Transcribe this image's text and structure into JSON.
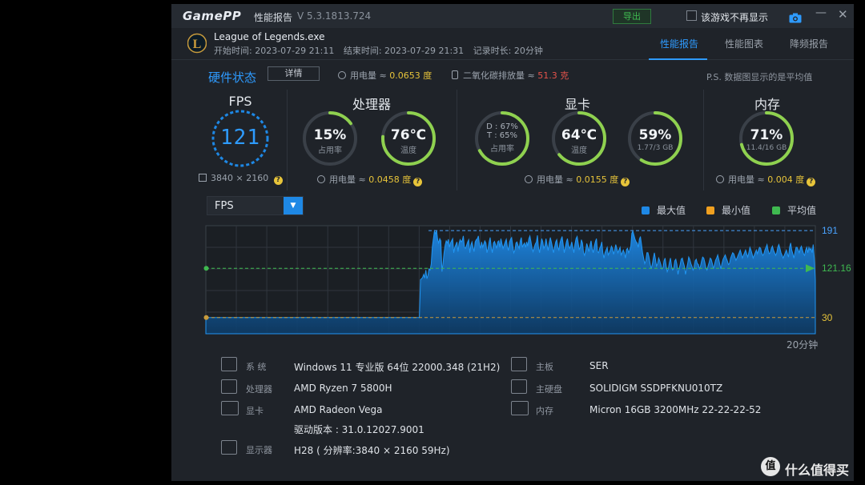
{
  "titlebar": {
    "logo": "GamePP",
    "title": "性能报告",
    "version": "V 5.3.1813.724",
    "export_label": "导出",
    "hide_game_label": "该游戏不再显示"
  },
  "header": {
    "exe": "League of Legends.exe",
    "start": "开始时间: 2023-07-29 21:11",
    "end": "结束时间: 2023-07-29 21:31",
    "duration": "记录时长: 20分钟",
    "game_icon_letter": "L",
    "tabs": [
      {
        "label": "性能报告",
        "active": true
      },
      {
        "label": "性能图表",
        "active": false
      },
      {
        "label": "降频报告",
        "active": false
      }
    ]
  },
  "summary": {
    "title": "硬件状态",
    "detail_label": "详情",
    "power_label": "用电量 ≈",
    "power_value": "0.0653 度",
    "co2_label": "二氧化碳排放量 ≈",
    "co2_value": "51.3 克",
    "ps_note": "P.S. 数据图显示的是平均值"
  },
  "sections": {
    "fps": {
      "title": "FPS",
      "value": "121",
      "resolution": "3840 × 2160"
    },
    "cpu": {
      "title": "处理器",
      "power_label": "用电量 ≈",
      "power_value": "0.0458 度"
    },
    "gpu": {
      "title": "显卡",
      "power_label": "用电量 ≈",
      "power_value": "0.0155 度"
    },
    "mem": {
      "title": "内存",
      "power_label": "用电量 ≈",
      "power_value": "0.004 度"
    }
  },
  "gauges": {
    "cpu_usage": {
      "value": "15%",
      "label": "占用率",
      "fraction": 0.15
    },
    "cpu_temp": {
      "value": "76℃",
      "label": "温度",
      "fraction": 0.76
    },
    "gpu_usage": {
      "line1": "D : 67%",
      "line2": "T : 65%",
      "label": "占用率",
      "fraction": 0.67
    },
    "gpu_temp": {
      "value": "64℃",
      "label": "温度",
      "fraction": 0.64
    },
    "gpu_mem": {
      "value": "59%",
      "label": "1.77/3 GB",
      "fraction": 0.59
    },
    "mem": {
      "value": "71%",
      "label": "11.4/16 GB",
      "fraction": 0.71
    }
  },
  "chart_controls": {
    "select_value": "FPS",
    "legend": [
      {
        "label": "最大值",
        "color": "#1e88e5"
      },
      {
        "label": "最小值",
        "color": "#f0a020"
      },
      {
        "label": "平均值",
        "color": "#3fb950"
      }
    ],
    "x_unit": "20分钟"
  },
  "chart_data": {
    "type": "area",
    "title": "",
    "xlabel": "20分钟",
    "ylabel": "",
    "ylim": [
      0,
      200
    ],
    "max_label": "191",
    "avg_label": "121.16",
    "min_label": "30",
    "max": 191,
    "avg": 121.16,
    "min": 30,
    "series": [
      {
        "values": [
          30,
          30,
          30,
          30,
          30,
          30,
          30,
          30,
          30,
          30,
          30,
          30,
          30,
          30,
          30,
          30,
          30,
          30,
          30,
          30,
          30,
          30,
          30,
          30,
          30,
          30,
          30,
          30,
          30,
          30,
          30,
          30,
          30,
          30,
          30,
          30,
          30,
          30,
          30,
          30,
          30,
          30,
          30,
          30,
          30,
          30,
          30,
          30,
          30,
          30,
          30,
          30,
          30,
          30,
          30,
          30,
          30,
          30,
          30,
          30,
          30,
          30,
          30,
          30,
          30,
          30,
          30,
          30,
          30,
          30,
          30,
          30,
          30,
          30,
          30,
          30,
          30,
          30,
          30,
          30,
          30,
          30,
          30,
          30,
          30,
          30,
          30,
          30,
          30,
          30,
          30,
          30,
          30,
          30,
          30,
          30,
          30,
          30,
          30,
          30,
          30,
          30,
          30,
          30,
          30,
          30,
          30,
          30,
          30,
          30,
          30,
          30,
          30,
          30,
          30,
          30,
          30,
          30,
          30,
          30,
          30,
          30,
          30,
          30,
          30,
          30,
          30,
          30,
          30,
          30,
          30,
          30,
          30,
          30,
          30,
          30,
          30,
          30,
          30,
          30,
          30,
          30,
          30,
          30,
          30,
          30,
          30,
          30,
          30,
          30,
          30,
          30,
          30,
          30,
          30,
          30,
          30,
          30,
          30,
          30,
          30,
          30,
          30,
          30,
          30,
          30,
          30,
          30,
          30,
          30,
          30,
          30,
          30,
          30,
          30,
          30,
          30,
          30,
          30,
          30,
          30,
          30,
          30,
          30,
          30,
          30,
          30,
          30,
          30,
          30,
          30,
          30,
          30,
          30,
          30,
          30,
          30,
          30,
          30,
          30,
          100,
          102,
          104,
          110,
          103,
          118,
          102,
          108,
          120,
          118,
          129,
          160,
          175,
          190,
          185,
          191,
          175,
          168,
          176,
          172,
          115,
          130,
          150,
          164,
          172,
          168,
          175,
          160,
          168,
          172,
          176,
          150,
          160,
          165,
          170,
          152,
          168,
          174,
          170,
          173,
          181,
          160,
          158,
          164,
          170,
          174,
          150,
          164,
          170,
          160,
          152,
          170,
          174,
          176,
          181,
          165,
          158,
          170,
          160,
          166,
          172,
          168,
          150,
          158,
          170,
          178,
          160,
          150,
          168,
          171,
          165,
          158,
          170,
          172,
          160,
          176,
          166,
          158,
          164,
          170,
          175,
          161,
          154,
          170,
          175,
          178,
          163,
          150,
          155,
          168,
          170,
          163,
          158,
          172,
          178,
          160,
          165,
          168,
          160,
          170,
          162,
          176,
          181,
          170,
          158,
          152,
          160,
          166,
          170,
          182,
          160,
          150,
          164,
          176,
          170,
          158,
          163,
          176,
          164,
          154,
          168,
          178,
          170,
          160,
          150,
          160,
          170,
          174,
          160,
          155,
          168,
          175,
          180,
          166,
          150,
          160,
          170,
          176,
          164,
          158,
          162,
          170,
          160,
          150,
          166,
          176,
          180,
          168,
          156,
          160,
          174,
          168,
          150,
          145,
          155,
          167,
          160,
          152,
          164,
          172,
          158,
          150,
          162,
          170,
          176,
          152,
          150,
          158,
          162,
          170,
          150,
          140,
          150,
          155,
          160,
          146,
          150,
          155,
          162,
          158,
          147,
          155,
          165,
          158,
          150,
          155,
          160,
          146,
          150,
          155,
          150,
          140,
          156,
          158,
          150,
          155,
          162,
          186,
          190,
          182,
          175,
          170,
          168,
          160,
          175,
          180,
          165,
          150,
          140,
          130,
          135,
          150,
          150,
          142,
          130,
          120,
          128,
          140,
          150,
          138,
          125,
          130,
          140,
          135,
          128,
          120,
          122,
          135,
          140,
          125,
          115,
          120,
          132,
          140,
          125,
          118,
          120,
          135,
          138,
          128,
          110,
          120,
          128,
          138,
          140,
          132,
          125,
          110,
          120,
          130,
          142,
          138,
          130,
          125,
          118,
          122,
          135,
          138,
          130,
          128,
          120,
          125,
          135,
          142,
          140,
          132,
          122,
          118,
          125,
          132,
          140,
          138,
          130,
          120,
          128,
          136,
          140,
          146,
          138,
          128,
          120,
          130,
          138,
          142,
          146,
          140,
          135,
          128,
          130,
          140,
          145,
          150,
          148,
          142,
          136,
          140,
          145,
          150,
          155,
          148,
          140,
          145,
          150,
          155,
          148,
          142,
          150,
          160,
          155,
          148,
          140,
          145,
          150,
          155,
          148,
          155,
          160,
          158,
          150,
          145,
          148,
          155,
          160,
          165,
          155,
          148,
          150,
          158,
          162,
          155,
          150,
          145,
          150,
          160,
          165,
          158,
          150,
          145,
          140,
          145,
          150,
          155,
          148,
          142,
          160,
          168,
          155,
          148,
          140,
          150,
          160,
          160,
          155,
          150,
          158,
          162,
          155,
          148,
          145,
          155,
          160,
          150,
          160,
          155,
          158,
          150,
          165,
          140,
          100
        ]
      }
    ]
  },
  "specs": {
    "left": [
      {
        "label": "系   统",
        "value": "Windows 11 专业版 64位 22000.348 (21H2)"
      },
      {
        "label": "处理器",
        "value": "AMD Ryzen 7 5800H"
      },
      {
        "label": "显卡",
        "value": "AMD Radeon Vega"
      },
      {
        "label": "",
        "value": "驱动版本 : 31.0.12027.9001"
      },
      {
        "label": "显示器",
        "value": "H28 ( 分辨率:3840 × 2160 59Hz)"
      }
    ],
    "right": [
      {
        "label": "主板",
        "value": "SER"
      },
      {
        "label": "主硬盘",
        "value": "SOLIDIGM SSDPFKNU010TZ"
      },
      {
        "label": "内存",
        "value": "Micron 16GB 3200MHz 22-22-22-52"
      }
    ]
  },
  "watermark": {
    "badge": "值",
    "text": "什么值得买"
  }
}
